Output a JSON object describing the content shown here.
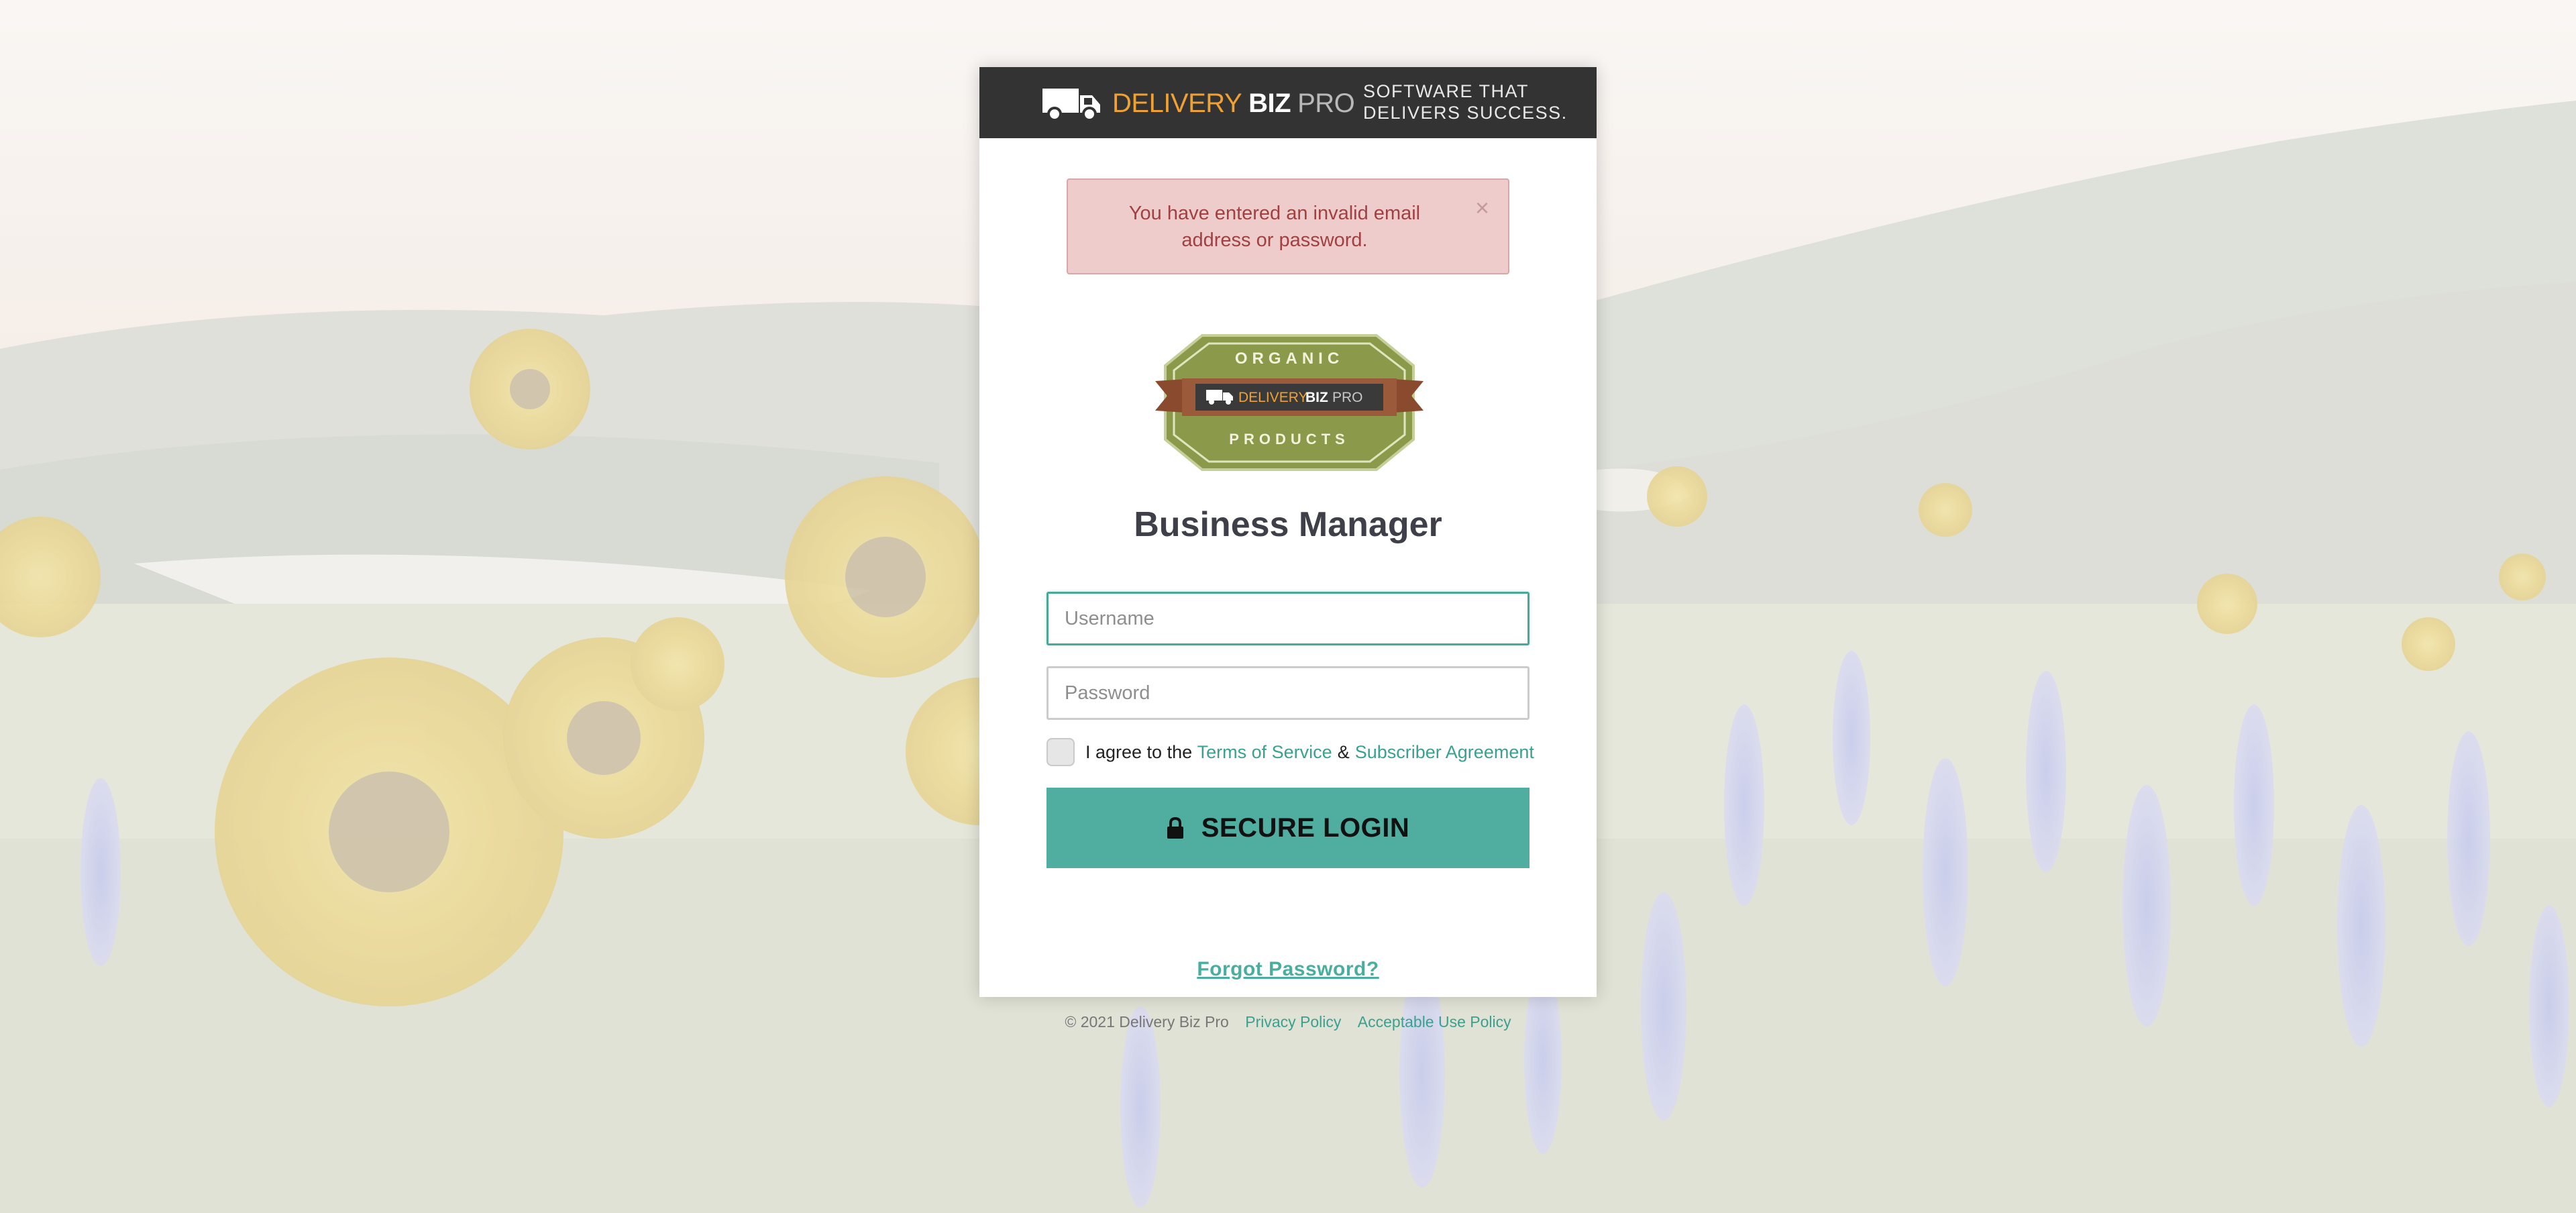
{
  "header": {
    "brand": {
      "word1": "DELIVERY",
      "word2": "BIZ",
      "word3": "PRO",
      "icon": "delivery-truck-icon"
    },
    "tagline_line1": "SOFTWARE THAT",
    "tagline_line2": "DELIVERS SUCCESS."
  },
  "alert": {
    "message": "You have entered an invalid email address or password.",
    "close_label": "×"
  },
  "badge": {
    "top_text": "ORGANIC",
    "bottom_text": "PRODUCTS",
    "brand1": "DELIVERY",
    "brand2": "BIZ",
    "brand3": "PRO",
    "colors": {
      "green": "#8a9a4a",
      "ribbon": "#9b5a3a",
      "dark": "#3a3a3a"
    }
  },
  "title": "Business Manager",
  "form": {
    "username_placeholder": "Username",
    "password_placeholder": "Password",
    "agree_text": "I agree to the",
    "terms_link": "Terms of Service",
    "amp": "&",
    "subscriber_link": "Subscriber Agreement",
    "login_label": "SECURE LOGIN",
    "forgot_label": "Forgot Password?"
  },
  "footer": {
    "copyright": "© 2021 Delivery Biz Pro",
    "privacy_link": "Privacy Policy",
    "aup_link": "Acceptable Use Policy"
  },
  "colors": {
    "accent": "#4fae9f",
    "alert_bg": "#eecccc",
    "alert_text": "#a04040",
    "header_bg": "#333333"
  }
}
